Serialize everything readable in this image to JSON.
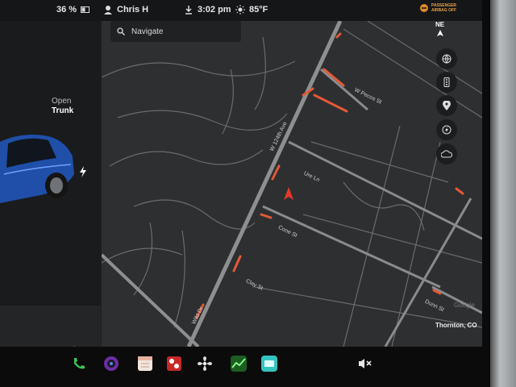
{
  "status_bar": {
    "battery": "36 %",
    "driver_name": "Chris H",
    "time": "3:02 pm",
    "temperature": "85°F",
    "airbag_status_line1": "PASSENGER",
    "airbag_status_line2": "AIRBAG OFF"
  },
  "car_panel": {
    "trunk_line1": "Open",
    "trunk_line2": "Trunk"
  },
  "map": {
    "search_placeholder": "Navigate",
    "compass_label": "NE",
    "streets": [
      "W 124th Ave",
      "Ure Ln",
      "Clay St",
      "Cone St",
      "Dunn St",
      "W Pecos St",
      "Wild Dr"
    ],
    "attribution": "Google",
    "location": "Thornton, CO"
  },
  "colors": {
    "accent_route": "#e35a36",
    "map_road": "#8a8b8d",
    "nav_arrow": "#e8382b"
  }
}
